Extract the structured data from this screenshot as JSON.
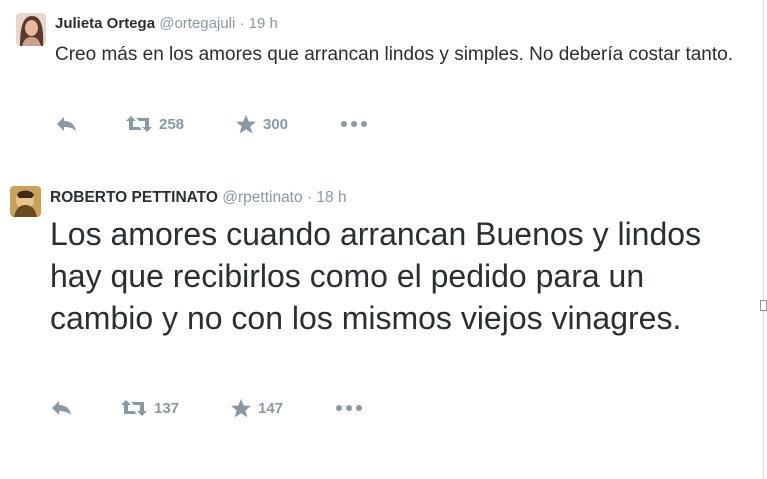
{
  "tweets": [
    {
      "fullname": "Julieta Ortega",
      "username": "@ortegajuli",
      "separator": "·",
      "time": "19 h",
      "text": "Creo más en los amores que arrancan lindos y simples. No debería costar tanto.",
      "retweets": "258",
      "favorites": "300",
      "avatar_icon": "user-avatar-photo"
    },
    {
      "fullname": "ROBERTO PETTINATO",
      "username": "@rpettinato",
      "separator": "·",
      "time": "18 h",
      "text": "Los amores cuando arrancan Buenos y lindos hay que recibirlos como el pedido para un cambio y no con los mismos viejos vinagres.",
      "retweets": "137",
      "favorites": "147",
      "avatar_icon": "user-avatar-photo"
    }
  ],
  "icons": {
    "reply": "reply-icon",
    "retweet": "retweet-icon",
    "favorite": "star-icon",
    "more": "more-icon"
  },
  "colors": {
    "name": "#292f33",
    "meta": "#8899a6",
    "text": "#292f33",
    "action": "#8899a6",
    "background": "#ffffff"
  }
}
